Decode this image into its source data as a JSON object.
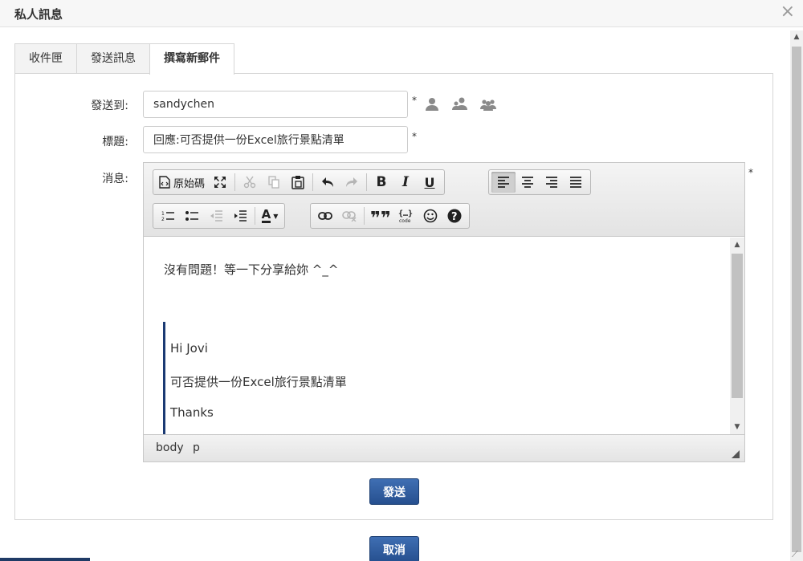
{
  "dialog": {
    "title": "私人訊息",
    "close_glyph": "×"
  },
  "tabs": [
    {
      "label": "收件匣",
      "active": false
    },
    {
      "label": "發送訊息",
      "active": false
    },
    {
      "label": "撰寫新郵件",
      "active": true
    }
  ],
  "form": {
    "to_label": "發送到:",
    "to_value": "sandychen",
    "subject_label": "標題:",
    "subject_value": "回應:可否提供一份Excel旅行景點清單",
    "message_label": "消息:",
    "required_mark": "*",
    "recipient_icons": [
      "single-user-icon",
      "user-group-icon",
      "users-group-icon"
    ]
  },
  "editor": {
    "toolbar": {
      "source_label": "原始碼",
      "bold": "B",
      "italic": "I",
      "underline": "U",
      "font_color": "A"
    },
    "content": {
      "reply_line": "沒有問題！等一下分享給妳 ^_^",
      "quote_lines": [
        "Hi Jovi",
        "可否提供一份Excel旅行景點清單",
        "Thanks"
      ]
    },
    "status_path": [
      "body",
      "p"
    ]
  },
  "actions": {
    "send_label": "發送",
    "cancel_label": "取消"
  },
  "colors": {
    "primary": "#2d5b9c",
    "quote_border": "#1b3a73"
  }
}
